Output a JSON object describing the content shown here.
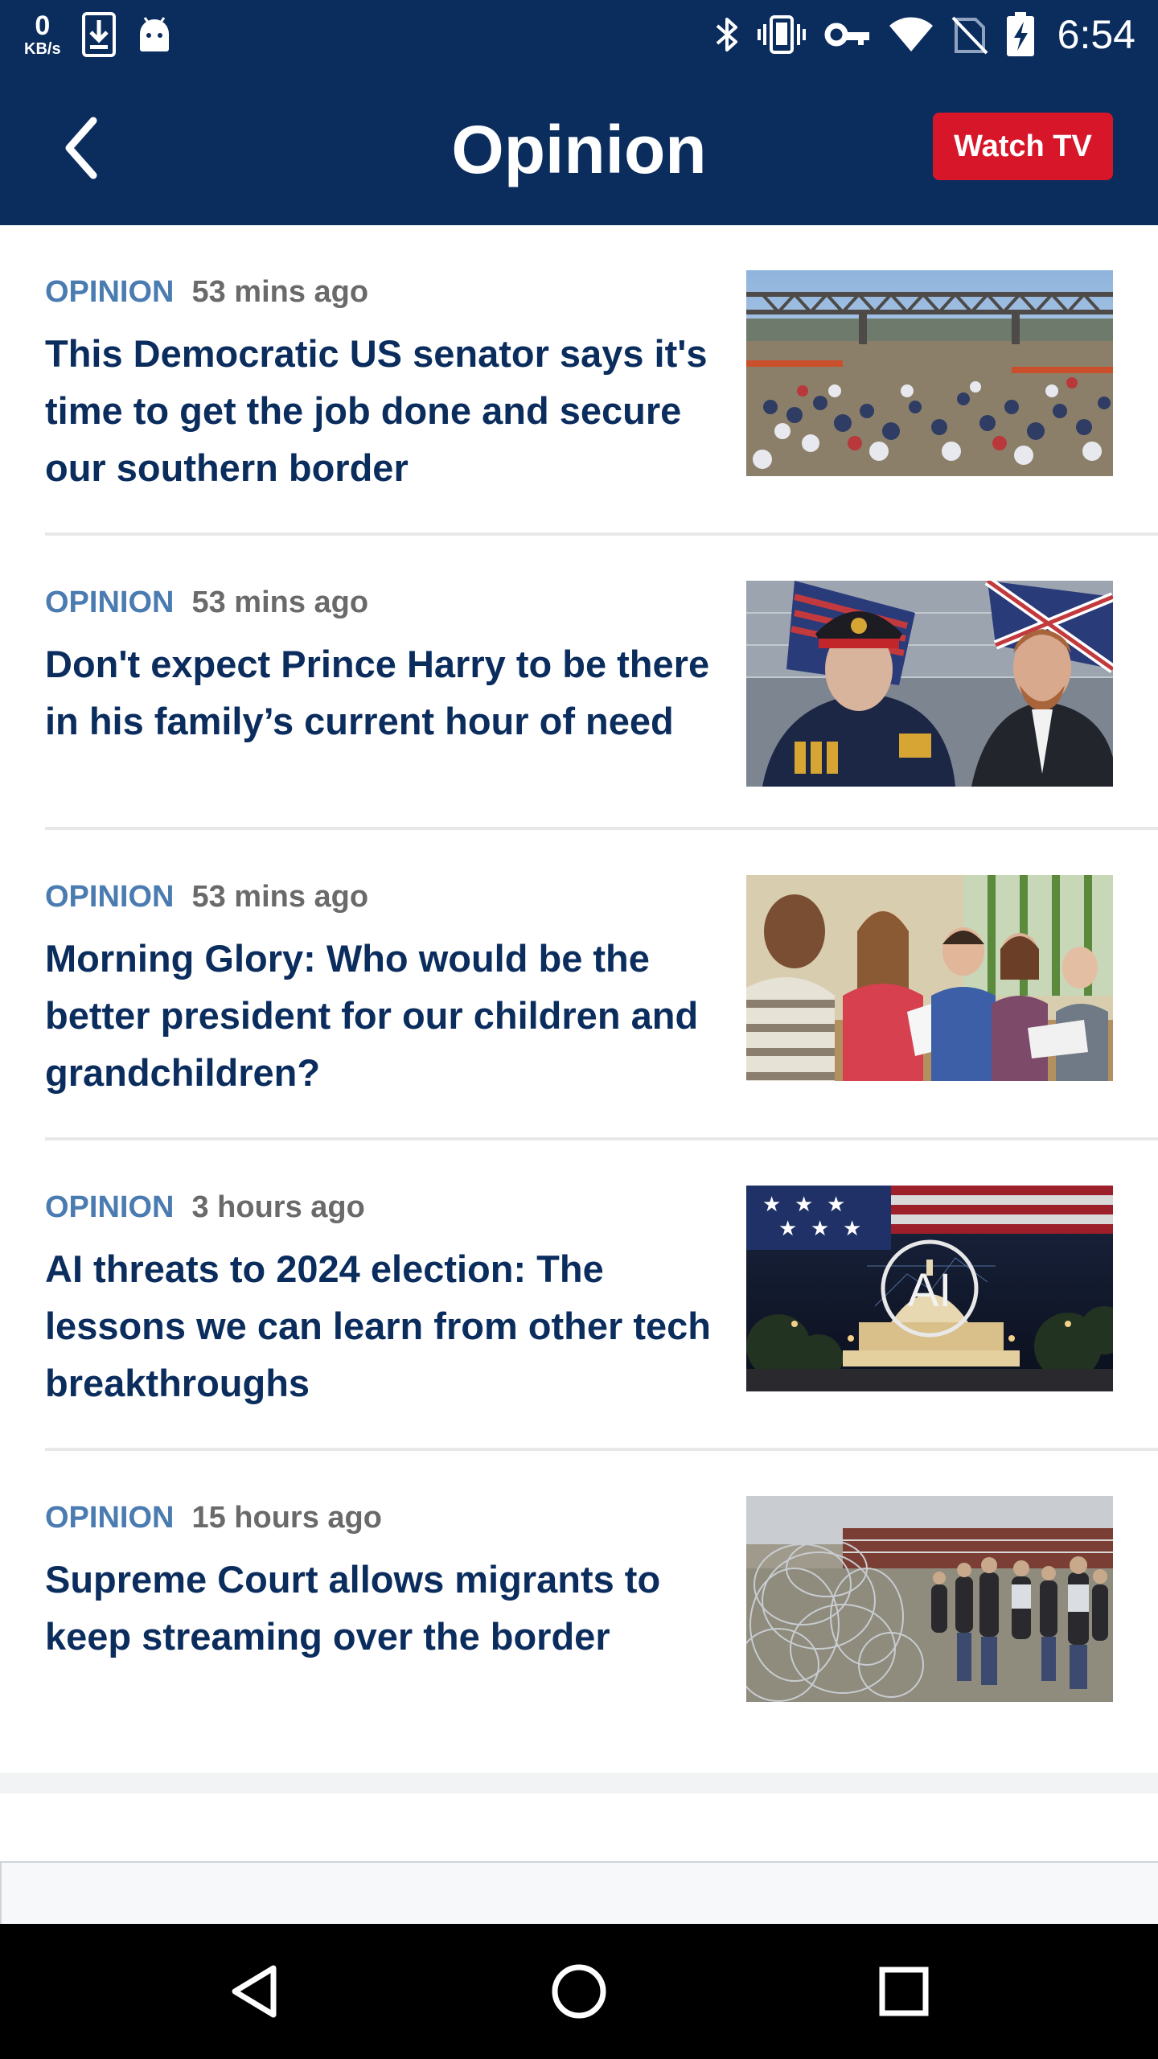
{
  "status_bar": {
    "speed_value": "0",
    "speed_unit": "KB/s",
    "time": "6:54",
    "icons": [
      "download-icon",
      "android-icon",
      "bluetooth-icon",
      "vibrate-icon",
      "vpn-key-icon",
      "wifi-icon",
      "no-sim-icon",
      "battery-icon"
    ]
  },
  "header": {
    "title": "Opinion",
    "watch_tv_label": "Watch TV",
    "accent_color": "#d7162a",
    "background_color": "#0b2d5e"
  },
  "articles": [
    {
      "tag": "OPINION",
      "time": "53 mins ago",
      "headline": "This Democratic US senator says it's time to get the job done and secure our southern border"
    },
    {
      "tag": "OPINION",
      "time": "53 mins ago",
      "headline": "Don't expect Prince Harry to be there in his family’s current hour of need"
    },
    {
      "tag": "OPINION",
      "time": "53 mins ago",
      "headline": "Morning Glory: Who would be the better president for our children and grandchildren?"
    },
    {
      "tag": "OPINION",
      "time": "3 hours ago",
      "headline": "AI threats to 2024 election: The lessons we can learn from other tech breakthroughs"
    },
    {
      "tag": "OPINION",
      "time": "15 hours ago",
      "headline": "Supreme Court allows migrants to keep streaming over the border"
    }
  ],
  "thumb_text": {
    "ai_badge": "AI"
  },
  "nav_bar": {
    "buttons": [
      "back-triangle-icon",
      "home-circle-icon",
      "recents-square-icon"
    ]
  }
}
